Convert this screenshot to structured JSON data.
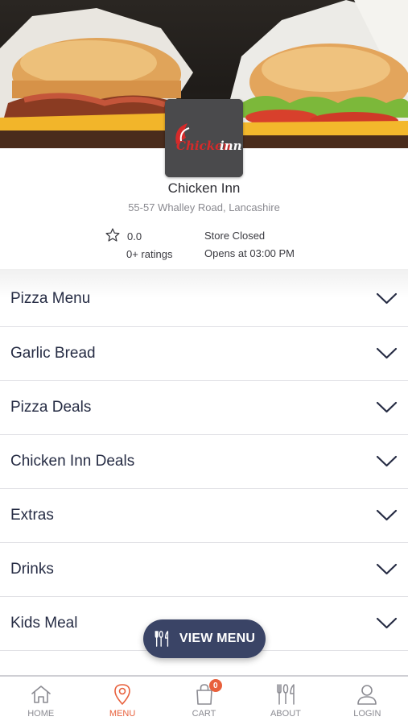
{
  "store": {
    "name": "Chicken Inn",
    "address": "55-57 Whalley Road, Lancashire",
    "logo_text": "Chicken inn",
    "rating": "0.0",
    "ratings_count": "0+ ratings",
    "status": "Store Closed",
    "opening": "Opens at 03:00 PM"
  },
  "menu": {
    "categories": [
      {
        "label": "Pizza Menu"
      },
      {
        "label": "Garlic Bread"
      },
      {
        "label": "Pizza Deals"
      },
      {
        "label": "Chicken Inn Deals"
      },
      {
        "label": "Extras"
      },
      {
        "label": "Drinks"
      },
      {
        "label": "Kids Meal"
      }
    ]
  },
  "view_menu": {
    "label": "VIEW MENU"
  },
  "bottom_nav": {
    "items": [
      {
        "label": "HOME",
        "icon": "home-icon"
      },
      {
        "label": "MENU",
        "icon": "location-pin-icon",
        "active": true
      },
      {
        "label": "CART",
        "icon": "shopping-bag-icon",
        "badge": "0"
      },
      {
        "label": "ABOUT",
        "icon": "cutlery-icon"
      },
      {
        "label": "LOGIN",
        "icon": "user-icon"
      }
    ]
  },
  "colors": {
    "accent": "#e8603c",
    "button": "#3a4466",
    "text": "#262c44",
    "divider": "#e1e1e6"
  }
}
